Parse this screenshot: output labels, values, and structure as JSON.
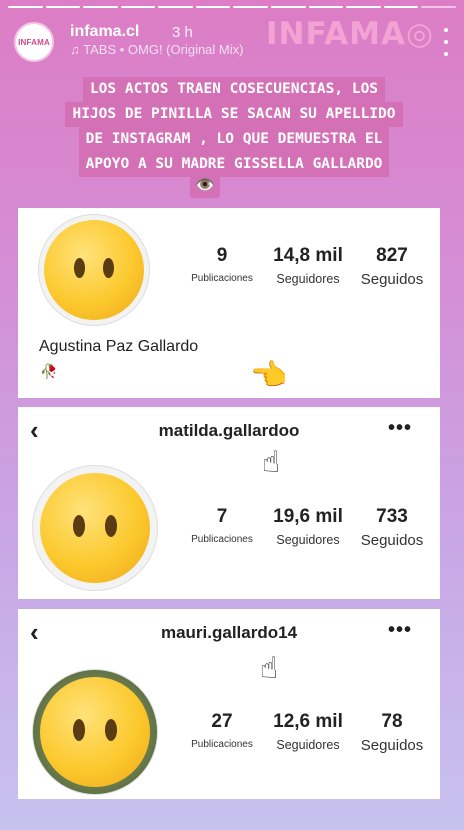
{
  "story": {
    "account": "infama.cl",
    "time": "3 h",
    "music": "TABS • OMG! (Original Mix)",
    "avatar_text": "INFAMA",
    "brand": "INFAMA",
    "caption_lines": [
      "LOS ACTOS TRAEN COSECUENCIAS, LOS",
      "HIJOS DE PINILLA SE SACAN SU APELLIDO",
      "DE INSTAGRAM , LO QUE DEMUESTRA EL",
      "APOYO A SU MADRE GISSELLA GALLARDO"
    ],
    "caption_emoji": "👁️"
  },
  "cards": [
    {
      "profile_name": "Agustina Paz Gallardo",
      "bio_emoji": "🥀",
      "hand_emoji": "👈",
      "stats": {
        "posts": "9",
        "posts_label": "Publicaciones",
        "followers": "14,8 mil",
        "followers_label": "Seguidores",
        "following": "827",
        "following_label": "Seguidos"
      }
    },
    {
      "username": "matilda.gallardoo",
      "hand_emoji": "☝",
      "stats": {
        "posts": "7",
        "posts_label": "Publicaciones",
        "followers": "19,6 mil",
        "followers_label": "Seguidores",
        "following": "733",
        "following_label": "Seguidos"
      }
    },
    {
      "username": "mauri.gallardo14",
      "hand_emoji": "☝",
      "stats": {
        "posts": "27",
        "posts_label": "Publicaciones",
        "followers": "12,6 mil",
        "followers_label": "Seguidores",
        "following": "78",
        "following_label": "Seguidos"
      }
    }
  ],
  "icons": {
    "back": "‹",
    "more": "•••"
  },
  "colors": {
    "caption_bg": "#d470b5",
    "brand": "#f3a3d3"
  }
}
